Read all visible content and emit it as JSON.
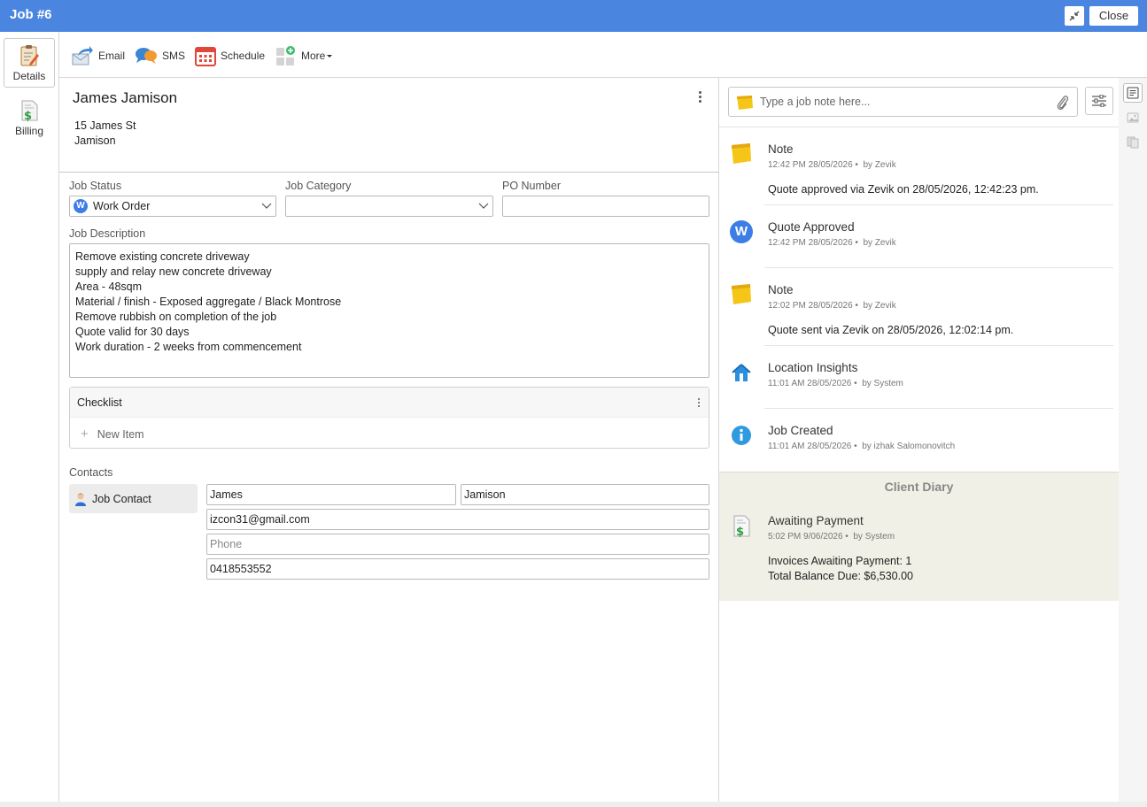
{
  "window": {
    "title": "Job #6",
    "close_label": "Close"
  },
  "sidebar": {
    "items": [
      {
        "label": "Details",
        "icon": "clipboard-edit-icon"
      },
      {
        "label": "Billing",
        "icon": "invoice-dollar-icon"
      }
    ]
  },
  "toolbar": {
    "email_label": "Email",
    "sms_label": "SMS",
    "schedule_label": "Schedule",
    "more_label": "More"
  },
  "client": {
    "name": "James Jamison",
    "address_line1": "15 James St",
    "address_line2": "Jamison"
  },
  "fields": {
    "job_status_label": "Job Status",
    "job_status_value": "Work Order",
    "job_status_badge": "W",
    "job_category_label": "Job Category",
    "job_category_value": "",
    "po_number_label": "PO Number",
    "po_number_value": "",
    "job_description_label": "Job Description",
    "job_description_lines": [
      "Remove existing concrete driveway",
      "supply and relay new concrete driveway",
      "Area - 48sqm",
      "Material / finish - Exposed aggregate / Black Montrose",
      "Remove rubbish on completion of the job",
      "Quote valid for 30 days",
      "Work duration - 2 weeks from commencement"
    ]
  },
  "checklist": {
    "title": "Checklist",
    "new_item_label": "New Item"
  },
  "contacts": {
    "label": "Contacts",
    "tab_label": "Job Contact",
    "first_name": "James",
    "last_name": "Jamison",
    "email": "izcon31@gmail.com",
    "phone_placeholder": "Phone",
    "mobile": "0418553552"
  },
  "notes": {
    "placeholder": "Type a job note here...",
    "feed": [
      {
        "icon": "sticky-note-icon",
        "title": "Note",
        "time": "12:42 PM 28/05/2026",
        "by": "by Zevik",
        "body": "Quote approved via Zevik on 28/05/2026, 12:42:23 pm."
      },
      {
        "icon": "work-order-badge-icon",
        "badge": "W",
        "title": "Quote Approved",
        "time": "12:42 PM 28/05/2026",
        "by": "by Zevik",
        "body": ""
      },
      {
        "icon": "sticky-note-icon",
        "title": "Note",
        "time": "12:02 PM 28/05/2026",
        "by": "by Zevik",
        "body": "Quote sent via Zevik on 28/05/2026, 12:02:14 pm."
      },
      {
        "icon": "house-icon",
        "title": "Location Insights",
        "time": "11:01 AM 28/05/2026",
        "by": "by System",
        "body": ""
      },
      {
        "icon": "info-icon",
        "title": "Job Created",
        "time": "11:01 AM 28/05/2026",
        "by": "by izhak Salomonovitch",
        "body": ""
      }
    ],
    "client_diary": {
      "title": "Client Diary",
      "item": {
        "icon": "invoice-dollar-icon",
        "title": "Awaiting Payment",
        "time": "5:02 PM 9/06/2026",
        "by": "by System",
        "body_line1": "Invoices Awaiting Payment: 1",
        "body_line2": "Total Balance Due: $6,530.00"
      }
    }
  },
  "colors": {
    "titlebar": "#4a86e0",
    "accent_blue": "#3d7ee6",
    "diary_bg": "#f1f0e6",
    "sticky_yellow": "#f5c518"
  }
}
